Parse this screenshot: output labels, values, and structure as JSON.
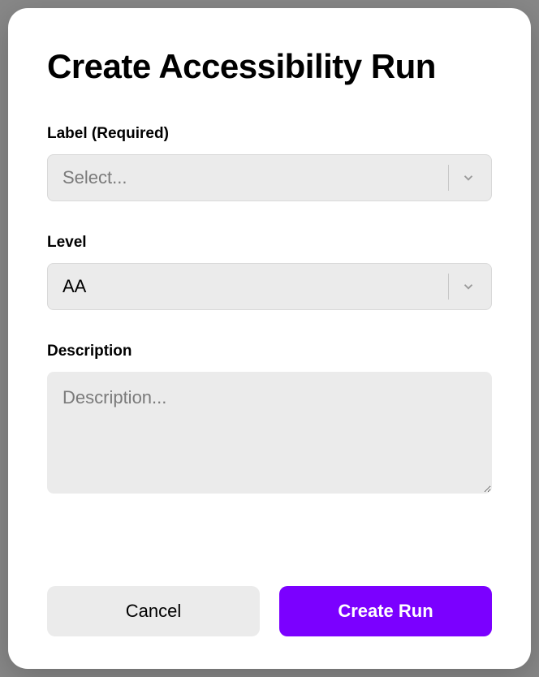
{
  "modal": {
    "title": "Create Accessibility Run",
    "fields": {
      "label": {
        "label": "Label (Required)",
        "placeholder": "Select...",
        "value": ""
      },
      "level": {
        "label": "Level",
        "value": "AA"
      },
      "description": {
        "label": "Description",
        "placeholder": "Description...",
        "value": ""
      }
    },
    "buttons": {
      "cancel": "Cancel",
      "submit": "Create Run"
    }
  },
  "colors": {
    "primary": "#7b00ff",
    "surface": "#ebebeb"
  }
}
